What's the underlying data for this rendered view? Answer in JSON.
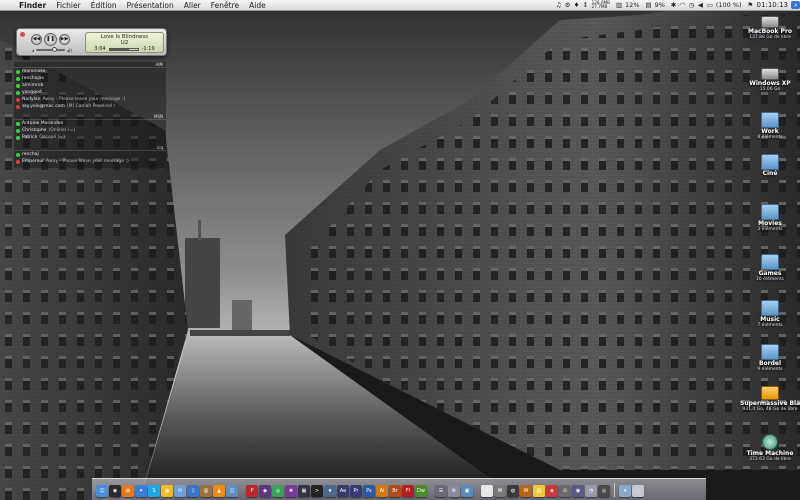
{
  "menubar": {
    "apple_icon": "apple-icon",
    "app_name": "Finder",
    "menus": [
      "Fichier",
      "Édition",
      "Présentation",
      "Aller",
      "Fenêtre",
      "Aide"
    ],
    "status": {
      "memory_line1": "128.0MB",
      "memory_line2": "27.7MB",
      "cpu": "12%",
      "cpu2": "9%",
      "battery": "(100 %)",
      "clock": "01:10:13"
    }
  },
  "miniplayer": {
    "title": "Love Is Blindness",
    "artist": "U2",
    "elapsed": "3:04",
    "remaining": "-1:19",
    "progress": 0.7,
    "volume": 0.65
  },
  "contacts": {
    "groups": [
      {
        "name": "AIM",
        "contacts": [
          {
            "name": "mononoke",
            "status": "online",
            "message": ""
          },
          {
            "name": "renchajav",
            "status": "online",
            "message": ""
          },
          {
            "name": "aimimrob",
            "status": "online",
            "message": ""
          },
          {
            "name": "yanggod",
            "status": "online",
            "message": ""
          },
          {
            "name": "Nadylan",
            "status": "away",
            "message": "Away - Please leave your message :)"
          },
          {
            "name": "sky.yolo@mac.com",
            "status": "away",
            "message": "(M) Canlah Powered !"
          }
        ]
      },
      {
        "name": "MSN",
        "contacts": [
          {
            "name": "Antoine Marandon",
            "status": "online",
            "message": ""
          },
          {
            "name": "Christophe",
            "status": "online",
            "message": "(Online) (=)"
          },
          {
            "name": "Patrick",
            "status": "online",
            "message": "Occupé (=)"
          }
        ]
      },
      {
        "name": "icq",
        "contacts": [
          {
            "name": "renchaj",
            "status": "online",
            "message": ""
          },
          {
            "name": "Empereur",
            "status": "away",
            "message": "Away - Please leave your message :)"
          }
        ]
      }
    ]
  },
  "desktop_icons": [
    {
      "label": "MacBook Pro",
      "sub": "137.88 Go de libre",
      "kind": "disk"
    },
    {
      "label": "Windows XP",
      "sub": "15.06 Go",
      "kind": "disk"
    },
    {
      "label": "Work",
      "sub": "8 éléments",
      "kind": "folder"
    },
    {
      "label": "Ciné",
      "sub": "",
      "kind": "folder"
    },
    {
      "label": "Movies",
      "sub": "3 éléments",
      "kind": "folder"
    },
    {
      "label": "Games",
      "sub": "16 éléments",
      "kind": "folder"
    },
    {
      "label": "Music",
      "sub": "7 éléments",
      "kind": "folder"
    },
    {
      "label": "Bordel",
      "sub": "9 éléments",
      "kind": "folder"
    },
    {
      "label": "Supermassive Black hole",
      "sub": "931.4 Go, 48 Go de libre",
      "kind": "orange"
    },
    {
      "label": "Time Machine",
      "sub": "372.63 Go de libre",
      "kind": "tm"
    }
  ],
  "dock": {
    "colors": {
      "bg": "#a0a0b0"
    },
    "apps_left": [
      {
        "name": "finder-icon",
        "color": "#4a8ed8",
        "glyph": "☺"
      },
      {
        "name": "dashboard-icon",
        "color": "#2b2b2b",
        "glyph": "◉"
      },
      {
        "name": "firefox-icon",
        "color": "#e37a22",
        "glyph": "◍"
      },
      {
        "name": "safari-icon",
        "color": "#3c7fd6",
        "glyph": "✦"
      },
      {
        "name": "skype-icon",
        "color": "#1ea7e6",
        "glyph": "S"
      },
      {
        "name": "adium-icon",
        "color": "#f2b92a",
        "glyph": "◕"
      },
      {
        "name": "mail-icon",
        "color": "#6da0d8",
        "glyph": "✉"
      },
      {
        "name": "itunes-icon",
        "color": "#3a72c6",
        "glyph": "♫"
      },
      {
        "name": "addressbook-icon",
        "color": "#9a7040",
        "glyph": "@"
      },
      {
        "name": "vlc-icon",
        "color": "#ef8a10",
        "glyph": "▲"
      },
      {
        "name": "iphoto-icon",
        "color": "#5f8fbf",
        "glyph": "◫"
      }
    ],
    "apps_middle": [
      {
        "name": "photoshop-icon",
        "color": "#b82a2a",
        "glyph": "P"
      },
      {
        "name": "indesign-icon",
        "color": "#5a3a7a",
        "glyph": "◆"
      },
      {
        "name": "colorsync-icon",
        "color": "#3aa05a",
        "glyph": "◎"
      },
      {
        "name": "preview-icon",
        "color": "#7a3a9a",
        "glyph": "❀"
      },
      {
        "name": "movie-icon",
        "color": "#333344",
        "glyph": "▦"
      },
      {
        "name": "terminal-icon",
        "color": "#222222",
        "glyph": ">"
      },
      {
        "name": "imovie-icon",
        "color": "#4a6a8a",
        "glyph": "★"
      },
      {
        "name": "aftereffects-icon",
        "color": "#3a3a6a",
        "glyph": "Ae"
      },
      {
        "name": "premiere-icon",
        "color": "#3a3a7a",
        "glyph": "Pr"
      },
      {
        "name": "photoshop2-icon",
        "color": "#2a5aa0",
        "glyph": "Ps"
      },
      {
        "name": "illustrator-icon",
        "color": "#d07a10",
        "glyph": "Ai"
      },
      {
        "name": "bridge-icon",
        "color": "#b04a1a",
        "glyph": "Br"
      },
      {
        "name": "flash-icon",
        "color": "#b02020",
        "glyph": "Fl"
      },
      {
        "name": "dreamweaver-icon",
        "color": "#4a8a2a",
        "glyph": "Dw"
      }
    ],
    "apps_right": [
      {
        "name": "automator-icon",
        "color": "#6a6a7a",
        "glyph": "☰"
      },
      {
        "name": "system-prefs-icon",
        "color": "#8a8a9a",
        "glyph": "⚙"
      },
      {
        "name": "exposé-icon",
        "color": "#5a8aba",
        "glyph": "▣"
      }
    ],
    "apps_tail": [
      {
        "name": "textedit-icon",
        "color": "#e6e6e6",
        "glyph": "✎"
      },
      {
        "name": "utility-icon",
        "color": "#7a7a7a",
        "glyph": "⌘"
      },
      {
        "name": "coda-icon",
        "color": "#3a3a3a",
        "glyph": "◍"
      },
      {
        "name": "xcode-icon",
        "color": "#b8621a",
        "glyph": "W"
      },
      {
        "name": "stickies-icon",
        "color": "#f0c83a",
        "glyph": "▤"
      },
      {
        "name": "image-icon",
        "color": "#c93a3a",
        "glyph": "◈"
      },
      {
        "name": "activity-icon",
        "color": "#6a6a6a",
        "glyph": "⊙"
      },
      {
        "name": "network-icon",
        "color": "#5a5a8a",
        "glyph": "◉"
      },
      {
        "name": "clock-icon",
        "color": "#9a9aaa",
        "glyph": "◔"
      },
      {
        "name": "radio-icon",
        "color": "#4a4a4a",
        "glyph": "◎"
      }
    ],
    "stacks": [
      {
        "name": "downloads-stack-icon",
        "color": "#8aa8c8",
        "glyph": "▾"
      },
      {
        "name": "trash-icon",
        "color": "#c8c8d0",
        "glyph": "◌"
      }
    ]
  }
}
